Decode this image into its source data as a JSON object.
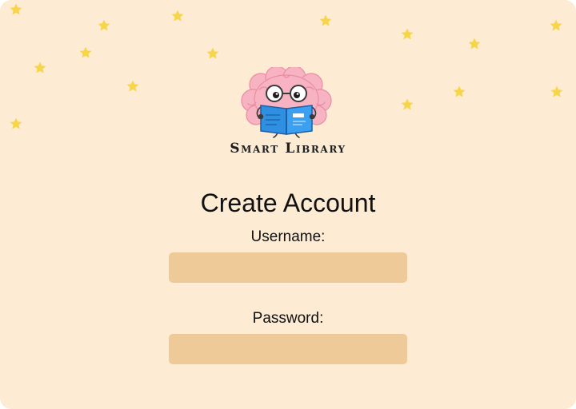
{
  "app": {
    "brand_name": "Smart Library",
    "logo_icon": "brain-reading-book-icon"
  },
  "form": {
    "title": "Create Account",
    "username_label": "Username:",
    "username_value": "",
    "password_label": "Password:",
    "password_value": ""
  },
  "colors": {
    "background": "#fdebd3",
    "input_fill": "#edca98",
    "star": "#f7d54a",
    "brain": "#f7b3c2",
    "book": "#2f8fe0"
  }
}
